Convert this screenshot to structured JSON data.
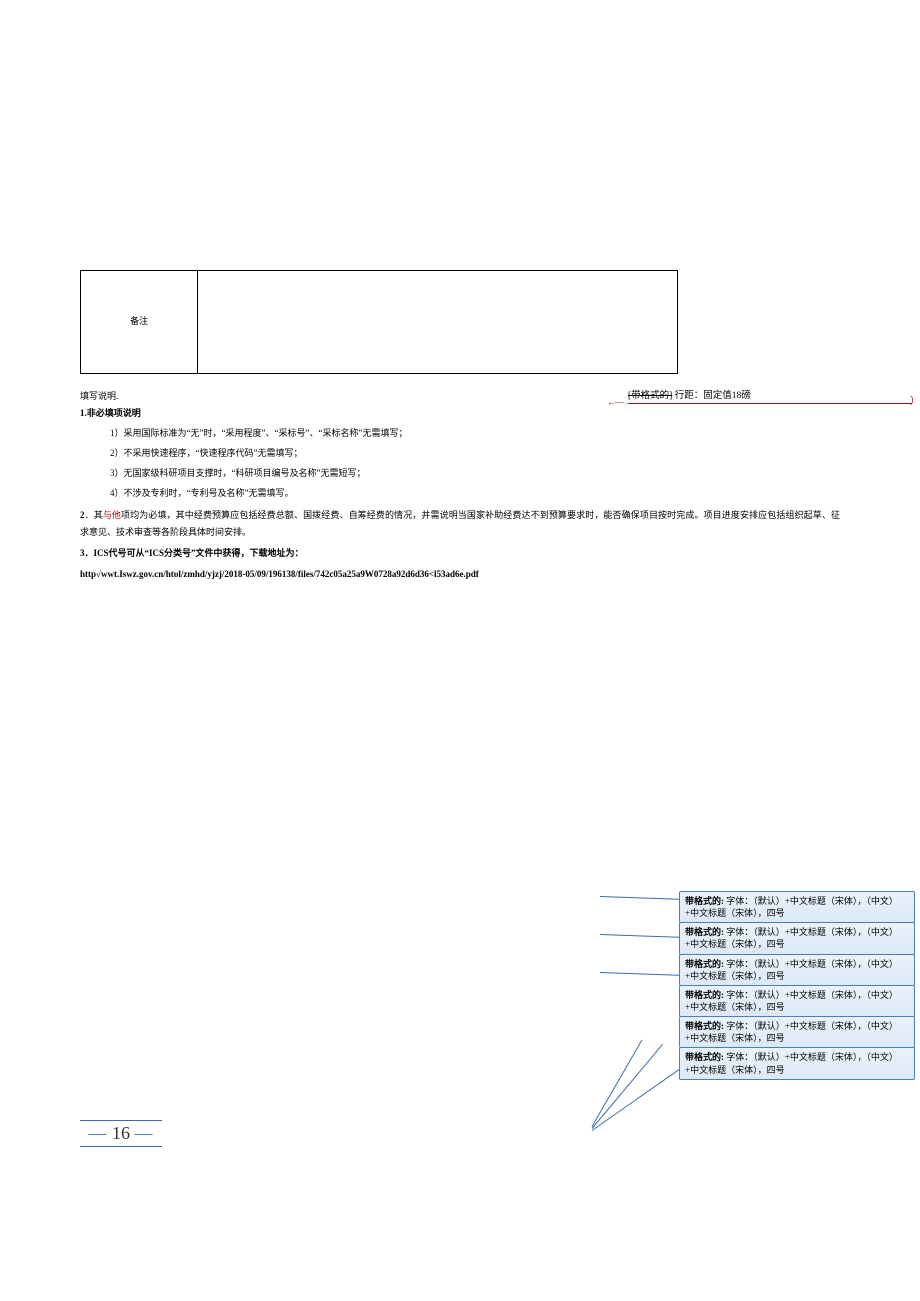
{
  "table": {
    "remarks_label": "备注"
  },
  "body": {
    "fill_heading": "填写说明.",
    "s1_heading": "1.非必填项说明",
    "s1_items": [
      "1）采用国际标准为“无”时，“采用程度”、“采标号”、“采标名称”无需填写；",
      "2）不采用快速程序，“快速程序代码”无需填写；",
      "3）无国家级科研项目支撑时，“科研项目编号及名称”无需短写；",
      "4）不涉及专利时，“专利号及名称”无需填写。"
    ],
    "s2_num": "2",
    "s2_prefix": "．其",
    "s2_red": "与他",
    "s2_rest": "项均为必填，其中经费预算应包括经费总额、国拨经费、自筹经费的情况，并需说明当国家补助经费达不到预算要求时，能否确保项目按时完成。项目进度安排应包括组织起草、征求意见、技术审查等各阶段具体时间安排。",
    "s3_num": "3",
    "s3_text": "．ICS代号可从“ICS分类号”文件中获得，下载地址为：",
    "url": "http√wwt.Iswz.gov.cn/htυl/zmhd/yjzj/2018-05/09/196138/files/742c05a25a9W0728a92d6d36<l53ad6e.pdf"
  },
  "revision": {
    "arrow": "←—",
    "label_strike": "[带格式的]",
    "text": " 行距：固定值18磅",
    "paren": "）"
  },
  "page_number": {
    "dash_left": "—",
    "num": "16",
    "dash_right": "—"
  },
  "balloons": [
    {
      "label": "带格式的:",
      "text": " 字体：（默认）+中文标题（宋体），（中文）+中文标题（宋体），四号"
    },
    {
      "label": "带格式的:",
      "text": " 字体：（默认）+中文标题（宋体），（中文）+中文标题（宋体），四号"
    },
    {
      "label": "带格式的:",
      "text": " 字体：（默认）+中文标题（宋体），（中文）+中文标题（宋体），四号"
    },
    {
      "label": "带格式的:",
      "text": " 字体：（默认）+中文标题（宋体），（中文）+中文标题（宋体），四号"
    },
    {
      "label": "带格式的:",
      "text": " 字体：（默认）+中文标题（宋体），（中文）+中文标题（宋体），四号"
    },
    {
      "label": "带格式的:",
      "text": " 字体：（默认）+中文标题（宋体），（中文）+中文标题（宋体），四号"
    }
  ]
}
